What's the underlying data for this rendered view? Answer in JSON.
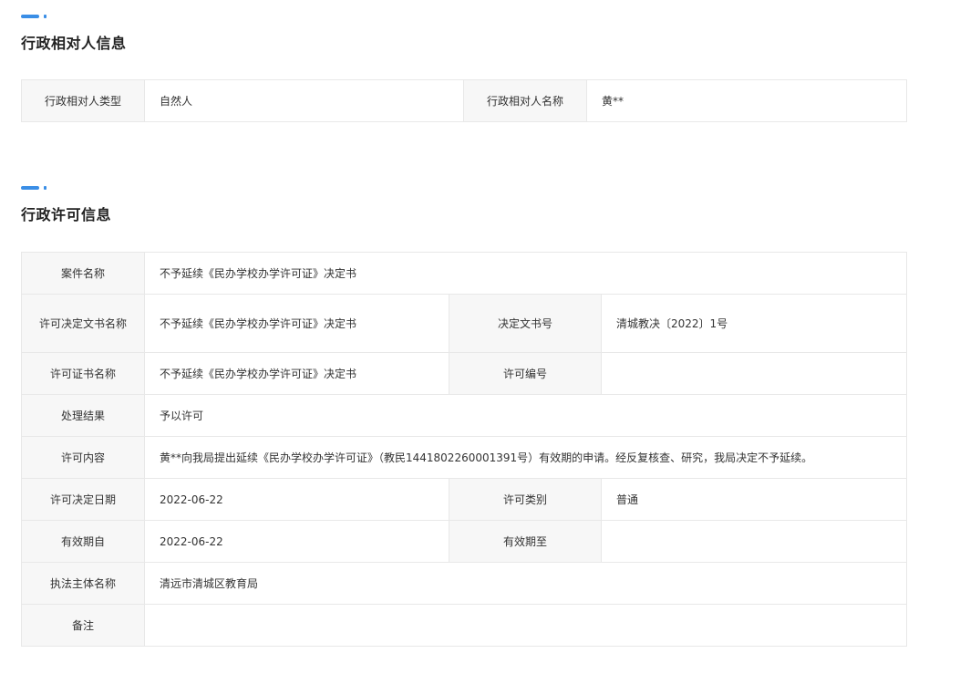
{
  "section1": {
    "title": "行政相对人信息",
    "rows": [
      {
        "label1": "行政相对人类型",
        "value1": "自然人",
        "label2": "行政相对人名称",
        "value2": "黄**"
      }
    ]
  },
  "section2": {
    "title": "行政许可信息",
    "case_name_label": "案件名称",
    "case_name_value": "不予延续《民办学校办学许可证》决定书",
    "doc_name_label": "许可决定文书名称",
    "doc_name_value": "不予延续《民办学校办学许可证》决定书",
    "doc_no_label": "决定文书号",
    "doc_no_value": "清城教决〔2022〕1号",
    "cert_name_label": "许可证书名称",
    "cert_name_value": "不予延续《民办学校办学许可证》决定书",
    "permit_no_label": "许可编号",
    "permit_no_value": "",
    "result_label": "处理结果",
    "result_value": "予以许可",
    "content_label": "许可内容",
    "content_value": "黄**向我局提出延续《民办学校办学许可证》（教民144180226000139­1号）有效期的申请。经反复核查、研究，我局决定不予延续。",
    "date_label": "许可决定日期",
    "date_value": "2022-06-22",
    "category_label": "许可类别",
    "category_value": "普通",
    "valid_from_label": "有效期自",
    "valid_from_value": "2022-06-22",
    "valid_to_label": "有效期至",
    "valid_to_value": "",
    "authority_label": "执法主体名称",
    "authority_value": "清远市清城区教育局",
    "remark_label": "备注",
    "remark_value": ""
  }
}
